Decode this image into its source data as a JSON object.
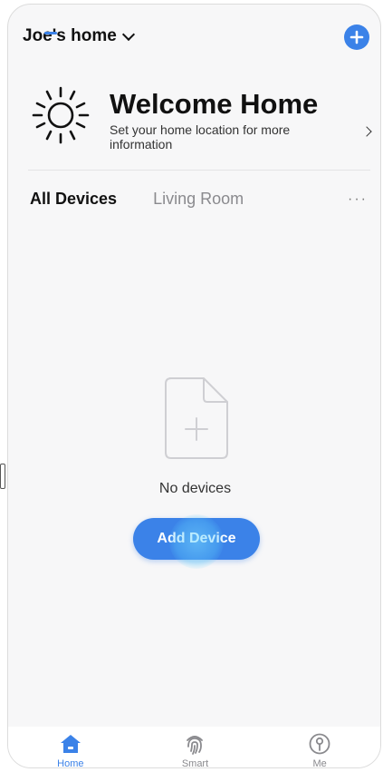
{
  "header": {
    "home_name": "Joe's home",
    "add_icon": "plus-circle-icon"
  },
  "welcome": {
    "title": "Welcome Home",
    "subtitle": "Set your home location for more information",
    "icon": "sun-icon"
  },
  "tabs": [
    {
      "label": "All Devices",
      "active": true
    },
    {
      "label": "Living Room",
      "active": false
    }
  ],
  "more_label": "···",
  "empty_state": {
    "message": "No devices",
    "button_label": "Add Device"
  },
  "bottom_nav": [
    {
      "label": "Home",
      "icon": "home-icon",
      "active": true
    },
    {
      "label": "Smart",
      "icon": "fingerprint-icon",
      "active": false
    },
    {
      "label": "Me",
      "icon": "user-icon",
      "active": false
    }
  ],
  "colors": {
    "accent": "#3b82e8",
    "background": "#f7f7f8",
    "text_primary": "#111111",
    "text_secondary": "#8a8a8e"
  }
}
